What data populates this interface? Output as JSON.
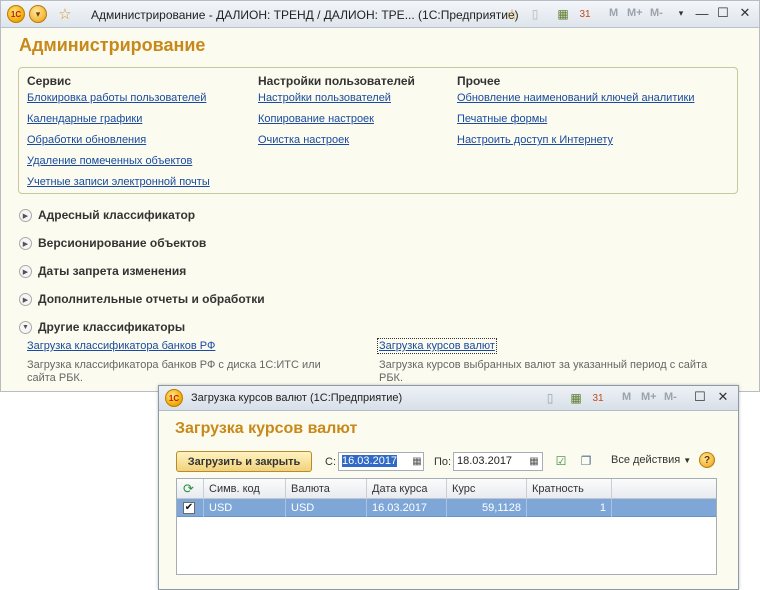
{
  "main_window": {
    "title": "Администрирование - ДАЛИОН: ТРЕНД / ДАЛИОН: ТРЕ...  (1С:Предприятие)",
    "m_buttons": [
      "M",
      "M+",
      "M-"
    ],
    "page_title": "Администрирование",
    "columns": [
      {
        "heading": "Сервис",
        "links": [
          "Блокировка работы пользователей",
          "Календарные графики",
          "Обработки обновления",
          "Удаление помеченных объектов",
          "Учетные записи электронной почты"
        ]
      },
      {
        "heading": "Настройки пользователей",
        "links": [
          "Настройки пользователей",
          "Копирование настроек",
          "Очистка настроек"
        ]
      },
      {
        "heading": "Прочее",
        "links": [
          "Обновление наименований ключей аналитики",
          "Печатные формы",
          "Настроить доступ к Интернету"
        ]
      }
    ],
    "groups": [
      "Адресный классификатор",
      "Версионирование объектов",
      "Даты запрета изменения",
      "Дополнительные отчеты и обработки",
      "Другие классификаторы"
    ],
    "other_classifiers": {
      "link_banks": "Загрузка классификатора банков РФ",
      "desc_banks": "Загрузка классификатора банков РФ с диска 1С:ИТС или сайта РБК.",
      "link_rates": "Загрузка курсов валют",
      "desc_rates": "Загрузка курсов выбранных валют за указанный период с сайта РБК."
    }
  },
  "dialog": {
    "title": "Загрузка курсов валют  (1С:Предприятие)",
    "m_buttons": [
      "M",
      "M+",
      "M-"
    ],
    "heading": "Загрузка курсов валют",
    "load_button": "Загрузить и закрыть",
    "from_label": "С:",
    "from_value": "16.03.2017",
    "to_label": "По:",
    "to_value": "18.03.2017",
    "all_actions": "Все действия",
    "help": "?",
    "table": {
      "columns": [
        "Симв. код",
        "Валюта",
        "Дата курса",
        "Курс",
        "Кратность"
      ],
      "rows": [
        {
          "checked": true,
          "code": "USD",
          "currency": "USD",
          "date": "16.03.2017",
          "rate": "59,1128",
          "multiplier": "1"
        }
      ]
    }
  },
  "colors": {
    "accent_heading": "#c8891a",
    "link": "#1a4ba0",
    "selected_row": "#7ea7d8"
  }
}
